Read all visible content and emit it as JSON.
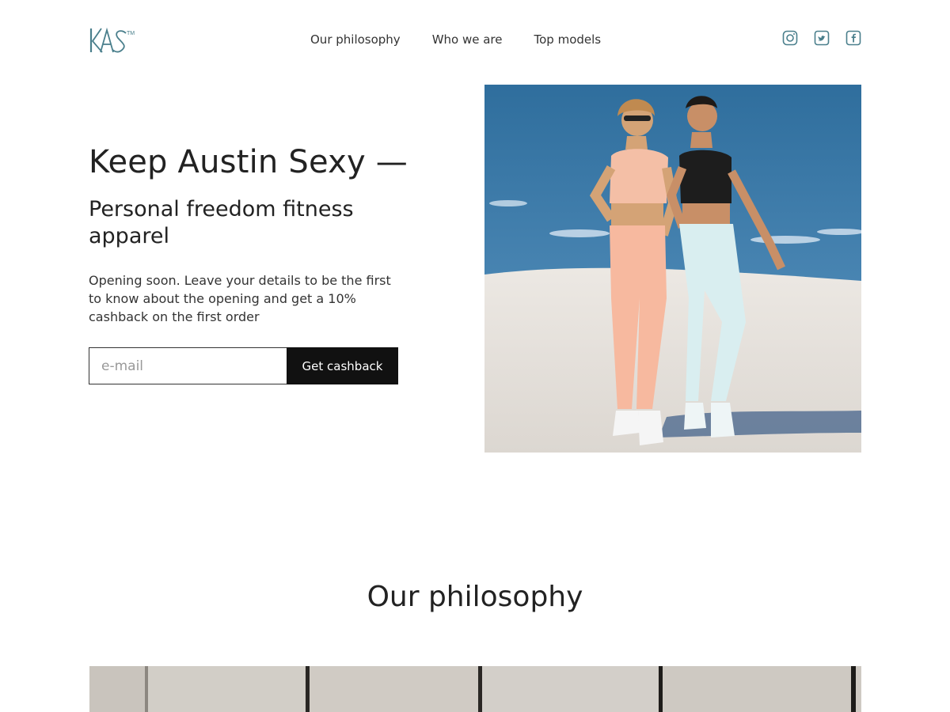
{
  "brand": {
    "logo_text": "KAS",
    "logo_tm": "TM",
    "accent": "#4a7f8c"
  },
  "nav": {
    "items": [
      {
        "label": "Our philosophy"
      },
      {
        "label": "Who we are"
      },
      {
        "label": "Top models"
      }
    ]
  },
  "social": {
    "icons": [
      "instagram-icon",
      "twitter-icon",
      "facebook-icon"
    ]
  },
  "hero": {
    "title": "Keep Austin Sexy —",
    "subtitle": "Personal freedom fitness apparel",
    "text": "Opening soon. Leave your details to be the first to know about the opening and get a 10% cashback on the first order",
    "email_placeholder": "e-mail",
    "email_value": "",
    "button_label": "Get cashback"
  },
  "philosophy": {
    "title": "Our philosophy"
  }
}
